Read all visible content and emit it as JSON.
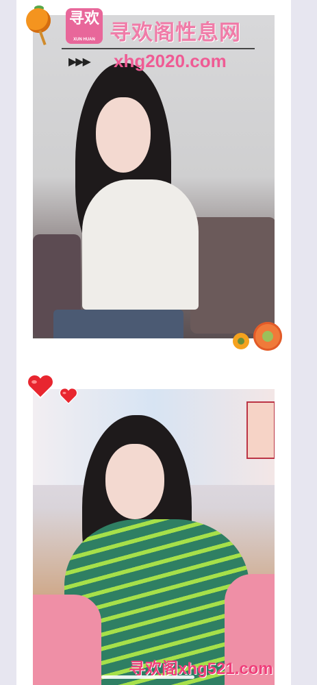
{
  "watermark_top": {
    "logo_text": "寻欢",
    "logo_subtext": "XUN HUAN",
    "site_name": "寻欢阁性息网",
    "arrow": "▶▶▶",
    "url": "xhg2020.com"
  },
  "watermark_bottom": {
    "text": "寻欢阁xhg521.com"
  },
  "icons": {
    "top_sticker": "orange-icon",
    "flowers": "flower-icon",
    "hearts": "heart-icon"
  },
  "colors": {
    "brand_pink": "#ef5b94",
    "page_bg": "#e7e6f0"
  }
}
